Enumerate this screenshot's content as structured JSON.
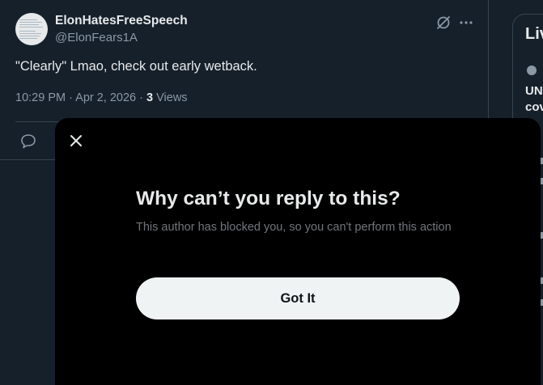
{
  "post": {
    "display_name": "ElonHatesFreeSpeech",
    "handle": "@ElonFears1A",
    "text": "\"Clearly\" Lmao, check out early wetback.",
    "timestamp": "10:29 PM · Apr 2, 2026 · ",
    "views_count": "3",
    "views_label": " Views"
  },
  "sidebar": {
    "title": "Liv",
    "headline_line1": "UN",
    "headline_line2": "cov"
  },
  "modal": {
    "title": "Why can’t you reply to this?",
    "body": "This author has blocked you, so you can't perform this action",
    "button_label": "Got It"
  },
  "icons": {
    "close": "close-icon",
    "grok": "grok-icon",
    "more": "more-icon",
    "reply": "reply-icon"
  },
  "colors": {
    "background": "#15202b",
    "modal_background": "#000000",
    "button_background": "#eff3f4",
    "muted_text": "#8b98a5"
  }
}
